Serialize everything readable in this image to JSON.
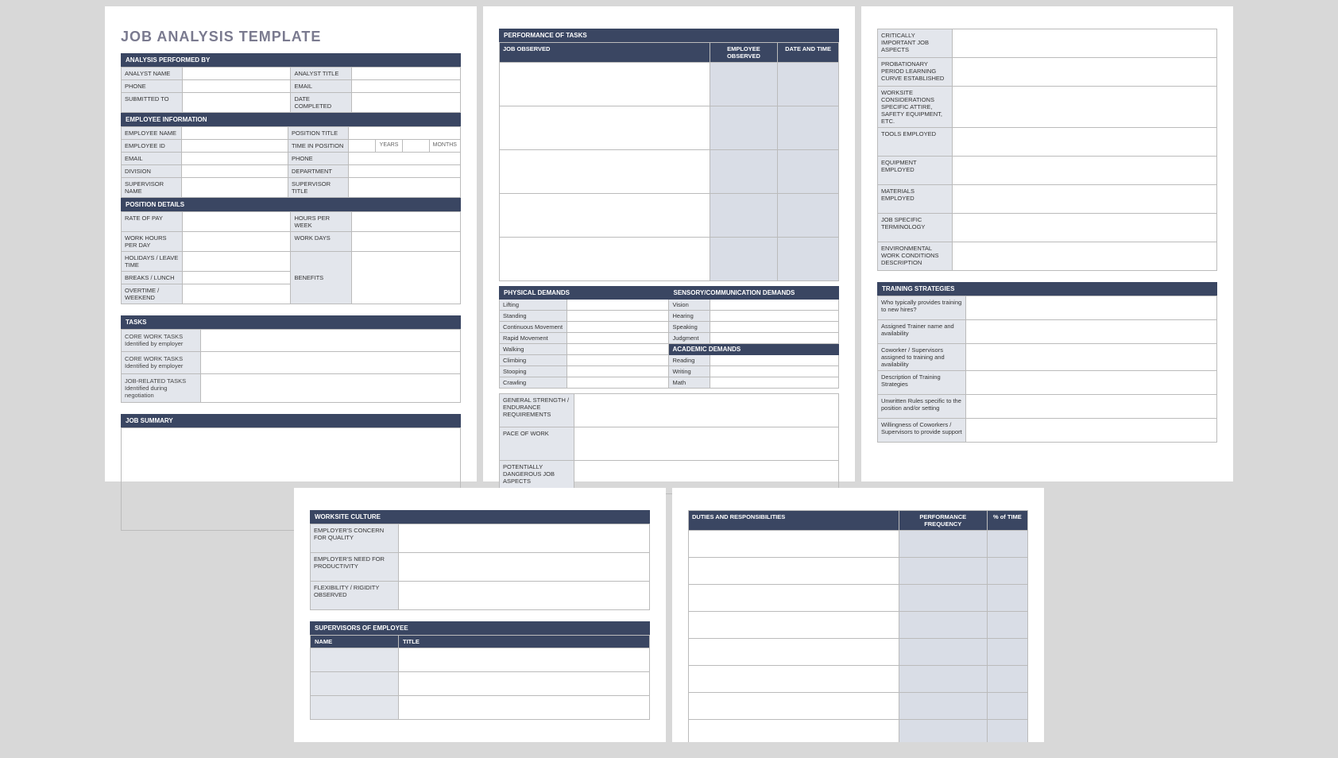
{
  "title": "JOB ANALYSIS TEMPLATE",
  "sections": {
    "analysis_performed_by": "ANALYSIS PERFORMED BY",
    "analyst_name": "ANALYST NAME",
    "analyst_title": "ANALYST TITLE",
    "phone": "PHONE",
    "email": "EMAIL",
    "submitted_to": "SUBMITTED TO",
    "date_completed": "DATE COMPLETED",
    "employee_information": "EMPLOYEE INFORMATION",
    "employee_name": "EMPLOYEE NAME",
    "position_title": "POSITION TITLE",
    "employee_id": "EMPLOYEE ID",
    "time_in_position": "TIME IN POSITION",
    "years": "YEARS",
    "months": "MONTHS",
    "email2": "EMAIL",
    "phone2": "PHONE",
    "division": "DIVISION",
    "department": "DEPARTMENT",
    "supervisor_name": "SUPERVISOR NAME",
    "supervisor_title": "SUPERVISOR TITLE",
    "position_details": "POSITION DETAILS",
    "rate_of_pay": "RATE OF PAY",
    "hours_per_week": "HOURS PER WEEK",
    "work_hours_per_day": "WORK HOURS PER DAY",
    "work_days": "WORK DAYS",
    "holidays_leave": "HOLIDAYS / LEAVE TIME",
    "benefits": "BENEFITS",
    "breaks_lunch": "BREAKS / LUNCH",
    "overtime_weekend": "OVERTIME / WEEKEND",
    "tasks": "TASKS",
    "core_work_tasks_1": "CORE WORK TASKS Identified by employer",
    "core_work_tasks_2": "CORE WORK TASKS Identified by employer",
    "job_related_tasks": "JOB-RELATED TASKS Identified during negotiation",
    "job_summary": "JOB SUMMARY"
  },
  "page2": {
    "performance_of_tasks": "PERFORMANCE OF TASKS",
    "job_observed": "JOB OBSERVED",
    "employee_observed": "EMPLOYEE OBSERVED",
    "date_and_time": "DATE AND TIME",
    "physical_demands": "PHYSICAL DEMANDS",
    "sensory_demands": "SENSORY/COMMUNICATION DEMANDS",
    "physical": {
      "lifting": "Lifting",
      "standing": "Standing",
      "continuous": "Continuous Movement",
      "rapid": "Rapid Movement",
      "walking": "Walking",
      "climbing": "Climbing",
      "stooping": "Stooping",
      "crawling": "Crawling"
    },
    "sensory": {
      "vision": "Vision",
      "hearing": "Hearing",
      "speaking": "Speaking",
      "judgment": "Judgment"
    },
    "academic_demands": "ACADEMIC DEMANDS",
    "academic": {
      "reading": "Reading",
      "writing": "Writing",
      "math": "Math"
    },
    "general_strength": "GENERAL STRENGTH / ENDURANCE REQUIREMENTS",
    "pace_of_work": "PACE OF WORK",
    "dangerous": "POTENTIALLY DANGEROUS JOB ASPECTS"
  },
  "page3": {
    "aspects": {
      "critically": "CRITICALLY IMPORTANT JOB ASPECTS",
      "probationary": "PROBATIONARY PERIOD LEARNING CURVE ESTABLISHED",
      "worksite": "WORKSITE CONSIDERATIONS Specific attire, safety equipment, etc.",
      "tools": "TOOLS EMPLOYED",
      "equipment": "EQUIPMENT EMPLOYED",
      "materials": "MATERIALS EMPLOYED",
      "terminology": "JOB SPECIFIC TERMINOLOGY",
      "environmental": "ENVIRONMENTAL WORK CONDITIONS DESCRIPTION"
    },
    "training_strategies": "TRAINING STRATEGIES",
    "training": {
      "who_provides": "Who typically provides training to new hires?",
      "assigned_trainer": "Assigned Trainer name and availability",
      "coworker": "Coworker / Supervisors assigned to training and availability",
      "description": "Description of Training Strategies",
      "unwritten": "Unwritten Rules specific to the position and/or setting",
      "willingness": "Willingness of Coworkers / Supervisors to provide support"
    }
  },
  "page4": {
    "worksite_culture": "WORKSITE CULTURE",
    "culture": {
      "quality": "EMPLOYER'S CONCERN FOR QUALITY",
      "productivity": "EMPLOYER'S NEED FOR PRODUCTIVITY",
      "flexibility": "FLEXIBILITY / RIGIDITY OBSERVED"
    },
    "supervisors": "SUPERVISORS OF EMPLOYEE",
    "name": "NAME",
    "title_col": "TITLE"
  },
  "page5": {
    "duties": "DUTIES AND RESPONSIBILITIES",
    "perf_freq": "PERFORMANCE FREQUENCY",
    "pct_time": "% of TIME"
  }
}
